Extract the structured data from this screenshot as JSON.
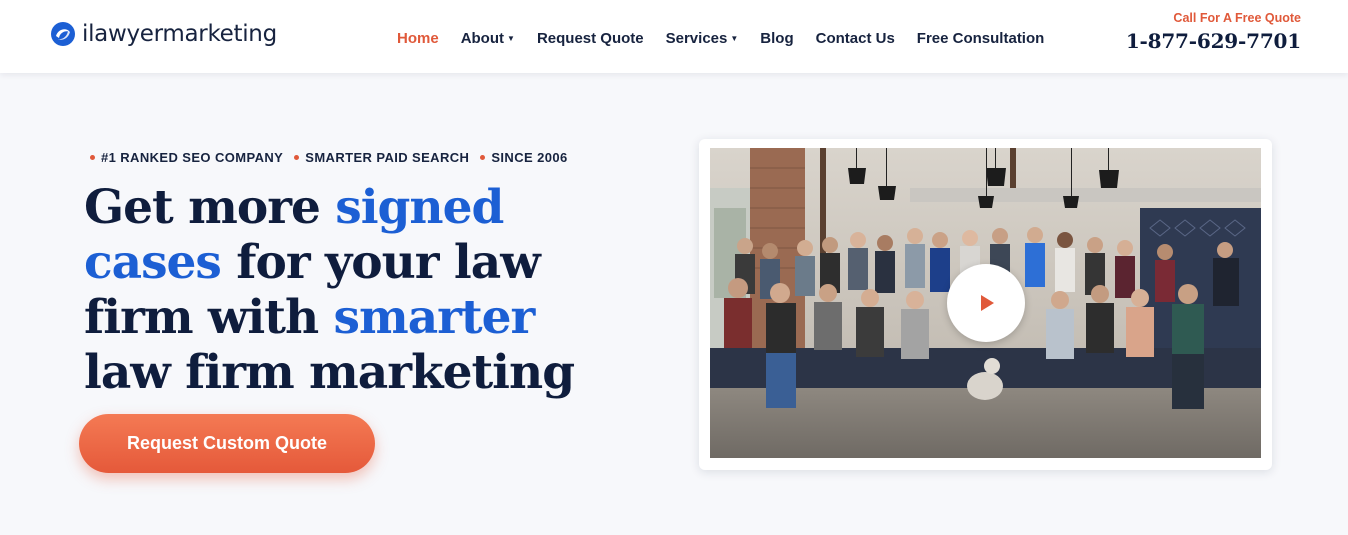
{
  "brand": {
    "name": "ilawyermarketing"
  },
  "nav": {
    "items": [
      {
        "label": "Home",
        "active": true,
        "has_dropdown": false
      },
      {
        "label": "About",
        "active": false,
        "has_dropdown": true
      },
      {
        "label": "Request Quote",
        "active": false,
        "has_dropdown": false
      },
      {
        "label": "Services",
        "active": false,
        "has_dropdown": true
      },
      {
        "label": "Blog",
        "active": false,
        "has_dropdown": false
      },
      {
        "label": "Contact Us",
        "active": false,
        "has_dropdown": false
      },
      {
        "label": "Free Consultation",
        "active": false,
        "has_dropdown": false
      }
    ]
  },
  "header_cta": {
    "label": "Call For A Free Quote",
    "phone": "1-877-629-7701"
  },
  "hero": {
    "badges": [
      "#1 RANKED SEO COMPANY",
      "SMARTER PAID SEARCH",
      "SINCE 2006"
    ],
    "headline": {
      "part1": "Get more ",
      "highlight1": "signed cases",
      "part2": " for your law firm with ",
      "highlight2": "smarter",
      "part3": " law firm marketing"
    },
    "button_label": "Request Custom Quote"
  },
  "video": {
    "icon": "play-icon"
  },
  "colors": {
    "accent": "#e0593a",
    "brand_blue": "#1c5fd4",
    "navy": "#0f1d3d"
  }
}
